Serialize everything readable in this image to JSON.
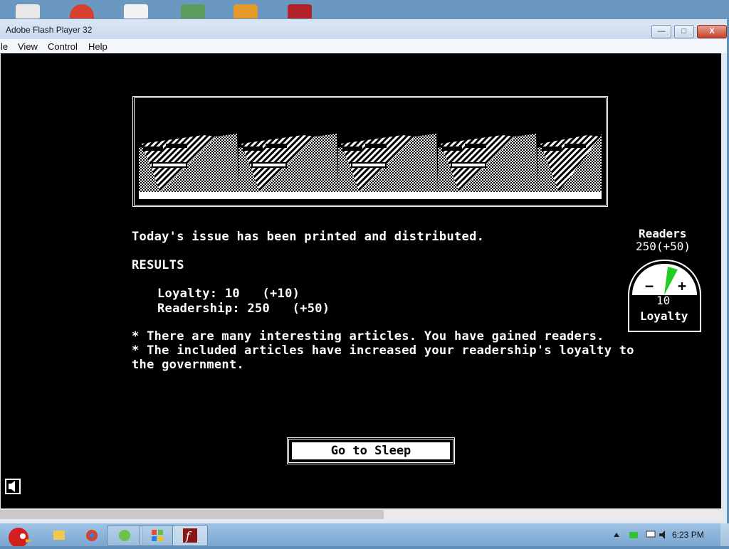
{
  "window": {
    "title": "Adobe Flash Player 32",
    "min_label": "—",
    "max_label": "□",
    "close_label": "X"
  },
  "menu": [
    "le",
    "View",
    "Control",
    "Help"
  ],
  "game": {
    "message": "Today's issue has been printed and distributed.",
    "results_heading": "RESULTS",
    "loyalty_line": "Loyalty: 10   (+10)",
    "readership_line": "Readership: 250   (+50)",
    "note_1": "* There are many interesting articles. You have gained readers.",
    "note_2": "* The included articles have increased your readership's loyalty to",
    "note_3": "the government.",
    "readers_title": "Readers",
    "readers_value": "250(+50)",
    "gauge_value": "10",
    "gauge_label": "Loyalty",
    "gauge_minus": "−",
    "gauge_plus": "+",
    "sleep_button": "Go to Sleep"
  },
  "taskbar": {
    "clock": "6:23 PM"
  },
  "colors": {
    "gauge_needle": "#22cc22",
    "stage_bg": "#000000",
    "taskbar": "#7aa6d0"
  }
}
